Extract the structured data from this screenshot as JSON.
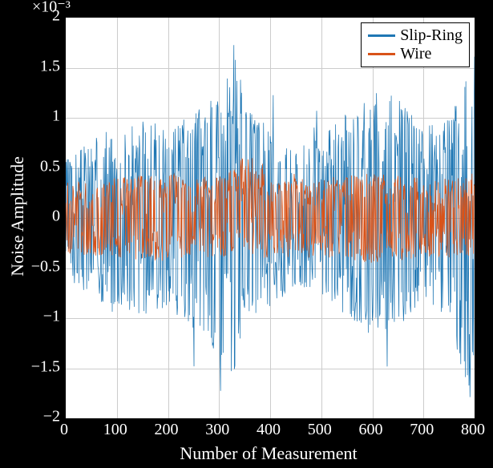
{
  "chart_data": {
    "type": "line",
    "title": "",
    "xlabel": "Number of Measurement",
    "ylabel": "Noise Amplitude",
    "xlim": [
      0,
      800
    ],
    "ylim": [
      -0.002,
      0.002
    ],
    "xticks": [
      0,
      100,
      200,
      300,
      400,
      500,
      600,
      700,
      800
    ],
    "yticks": [
      -0.002,
      -0.0015,
      -0.001,
      -0.0005,
      0,
      0.0005,
      0.001,
      0.0015,
      0.002
    ],
    "ytick_labels": [
      "−2",
      "−1.5",
      "−1",
      "−0.5",
      "0",
      "0.5",
      "1",
      "1.5",
      "2"
    ],
    "ytick_exponent_label": "×10⁻³",
    "legend_position": "top-right",
    "grid": true,
    "series": [
      {
        "name": "Slip-Ring",
        "color": "#1f77b4",
        "description": "Dense noise signal, approx 800 samples, amplitude roughly ±1.0e-3 with spikes reaching about ±1.8e-3",
        "envelope_upper_approx": [
          [
            0,
            0.0006
          ],
          [
            50,
            0.0008
          ],
          [
            100,
            0.0009
          ],
          [
            150,
            0.001
          ],
          [
            200,
            0.0009
          ],
          [
            250,
            0.0011
          ],
          [
            300,
            0.0013
          ],
          [
            330,
            0.0018
          ],
          [
            350,
            0.0011
          ],
          [
            400,
            0.0009
          ],
          [
            450,
            0.0007
          ],
          [
            500,
            0.0008
          ],
          [
            550,
            0.0011
          ],
          [
            600,
            0.0013
          ],
          [
            650,
            0.0012
          ],
          [
            700,
            0.0009
          ],
          [
            750,
            0.001
          ],
          [
            800,
            0.0017
          ]
        ],
        "envelope_lower_approx": [
          [
            0,
            -0.0006
          ],
          [
            50,
            -0.0008
          ],
          [
            100,
            -0.0009
          ],
          [
            150,
            -0.001
          ],
          [
            200,
            -0.0009
          ],
          [
            250,
            -0.0011
          ],
          [
            300,
            -0.0014
          ],
          [
            330,
            -0.0016
          ],
          [
            350,
            -0.001
          ],
          [
            400,
            -0.0009
          ],
          [
            450,
            -0.0007
          ],
          [
            500,
            -0.0008
          ],
          [
            550,
            -0.001
          ],
          [
            600,
            -0.0012
          ],
          [
            650,
            -0.0011
          ],
          [
            700,
            -0.0009
          ],
          [
            750,
            -0.001
          ],
          [
            790,
            -0.002
          ],
          [
            800,
            -0.0013
          ]
        ]
      },
      {
        "name": "Wire",
        "color": "#d95319",
        "description": "Dense noise signal, approx 800 samples, amplitude roughly ±0.4e-3 with occasional spikes to ±0.6e-3",
        "envelope_upper_approx": [
          [
            0,
            0.00035
          ],
          [
            100,
            0.0004
          ],
          [
            200,
            0.00045
          ],
          [
            300,
            0.0004
          ],
          [
            370,
            0.0007
          ],
          [
            400,
            0.0004
          ],
          [
            500,
            0.0004
          ],
          [
            600,
            0.00045
          ],
          [
            700,
            0.0004
          ],
          [
            800,
            0.0004
          ]
        ],
        "envelope_lower_approx": [
          [
            0,
            -0.00035
          ],
          [
            100,
            -0.0004
          ],
          [
            200,
            -0.00045
          ],
          [
            300,
            -0.0004
          ],
          [
            400,
            -0.0004
          ],
          [
            500,
            -0.0004
          ],
          [
            600,
            -0.00045
          ],
          [
            700,
            -0.0004
          ],
          [
            800,
            -0.0004
          ]
        ]
      }
    ]
  }
}
